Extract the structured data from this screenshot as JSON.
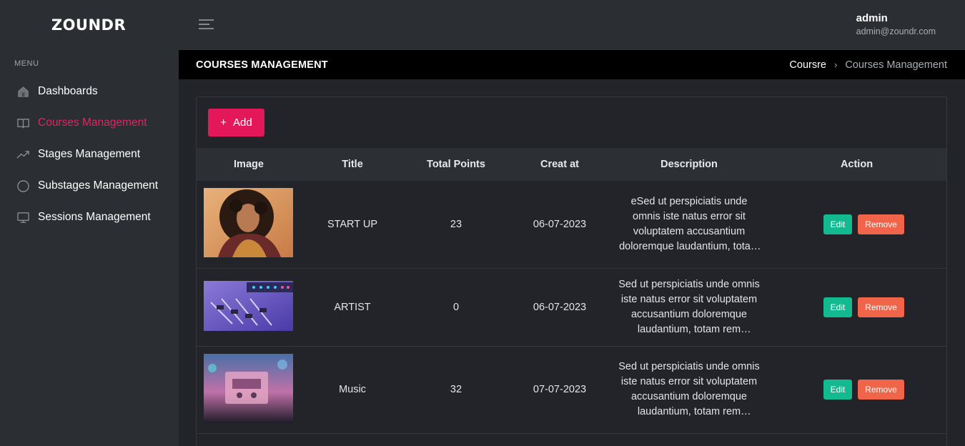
{
  "app": {
    "logo": "ZOUNDR"
  },
  "sidebar": {
    "menu_title": "MENU",
    "items": [
      {
        "label": "Dashboards",
        "icon": "home-icon"
      },
      {
        "label": "Courses Management",
        "icon": "book-icon",
        "active": true
      },
      {
        "label": "Stages Management",
        "icon": "trending-icon"
      },
      {
        "label": "Substages Management",
        "icon": "circle-icon"
      },
      {
        "label": "Sessions Management",
        "icon": "monitor-icon"
      }
    ]
  },
  "topbar": {
    "menu_icon": "hamburger-icon",
    "user_name": "admin",
    "user_email": "admin@zoundr.com"
  },
  "page": {
    "title": "COURSES MANAGEMENT",
    "breadcrumb": {
      "parent": "Coursre",
      "separator": "›",
      "current": "Courses Management"
    }
  },
  "toolbar": {
    "add_icon": "+",
    "add_label": "Add"
  },
  "table": {
    "headers": [
      "Image",
      "Title",
      "Total Points",
      "Creat at",
      "Description",
      "Action"
    ],
    "rows": [
      {
        "title": "START UP",
        "points": "23",
        "created": "06-07-2023",
        "description": "eSed ut perspiciatis unde omnis iste natus error sit voluptatem accusantium doloremque laudantium, totam rem aperiam",
        "edit": "Edit",
        "remove": "Remove"
      },
      {
        "title": "ARTIST",
        "points": "0",
        "created": "06-07-2023",
        "description": "Sed ut perspiciatis unde omnis iste natus error sit voluptatem accusantium doloremque laudantium, totam rem aperiam",
        "edit": "Edit",
        "remove": "Remove"
      },
      {
        "title": "Music",
        "points": "32",
        "created": "07-07-2023",
        "description": "Sed ut perspiciatis unde omnis iste natus error sit voluptatem accusantium doloremque laudantium, totam rem aperiam",
        "edit": "Edit",
        "remove": "Remove"
      }
    ]
  },
  "colors": {
    "accent": "#e3175a",
    "edit": "#13b98f",
    "remove": "#f0644a",
    "sidebar": "#2b2e32",
    "titlebar": "#000000"
  }
}
